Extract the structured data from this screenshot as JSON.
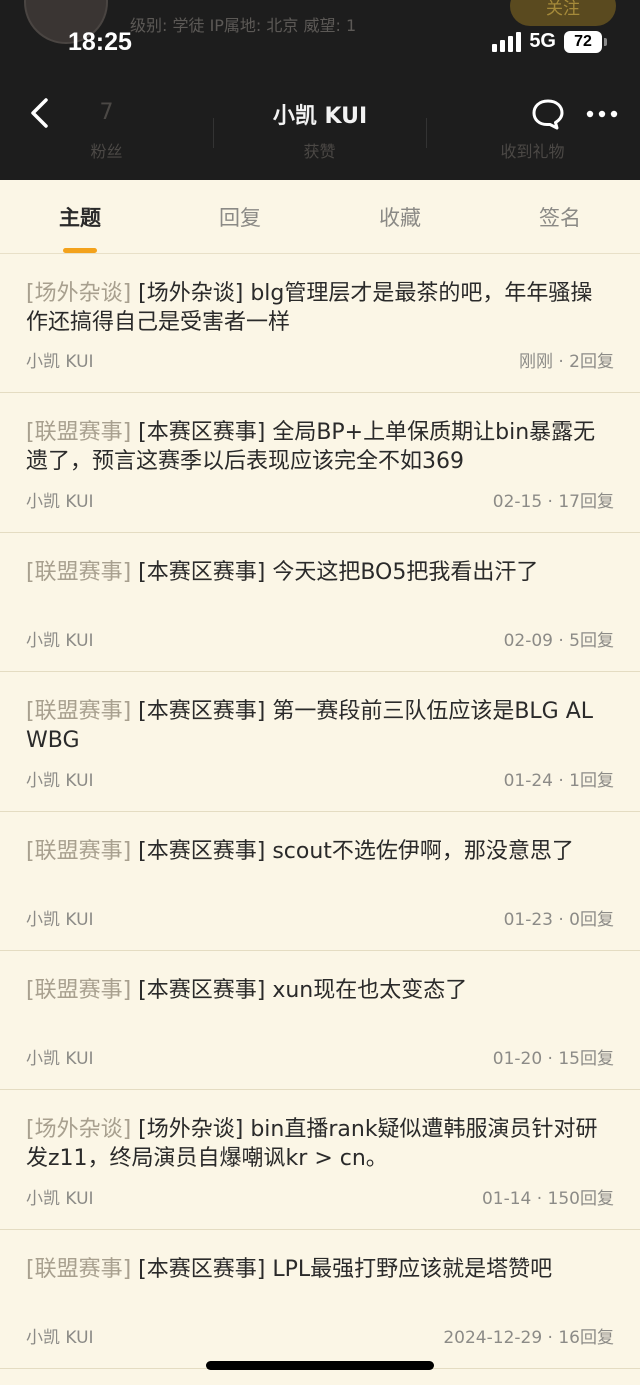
{
  "status_bar": {
    "time": "18:25",
    "network": "5G",
    "battery": "72"
  },
  "background_profile": {
    "meta_line": "级别: 学徒  IP属地: 北京  威望: 1",
    "follow_label": "关注",
    "stats": [
      {
        "num": "7",
        "label": "粉丝"
      },
      {
        "num": "",
        "label": "获赞"
      },
      {
        "num": "",
        "label": "收到礼物"
      }
    ]
  },
  "nav": {
    "title": "小凯 KUI"
  },
  "tabs": [
    {
      "label": "主题",
      "active": true
    },
    {
      "label": "回复",
      "active": false
    },
    {
      "label": "收藏",
      "active": false
    },
    {
      "label": "签名",
      "active": false
    }
  ],
  "posts": [
    {
      "forum": "[场外杂谈]",
      "title": " [场外杂谈] blg管理层才是最茶的吧，年年骚操作还搞得自己是受害者一样",
      "author": "小凯 KUI",
      "meta": "刚刚 · 2回复"
    },
    {
      "forum": "[联盟赛事]",
      "title": " [本赛区赛事] 全局BP+上单保质期让bin暴露无遗了，预言这赛季以后表现应该完全不如369",
      "author": "小凯 KUI",
      "meta": "02-15 · 17回复"
    },
    {
      "forum": "[联盟赛事]",
      "title": " [本赛区赛事] 今天这把BO5把我看出汗了",
      "author": "小凯 KUI",
      "meta": "02-09 · 5回复"
    },
    {
      "forum": "[联盟赛事]",
      "title": " [本赛区赛事] 第一赛段前三队伍应该是BLG AL WBG",
      "author": "小凯 KUI",
      "meta": "01-24 · 1回复"
    },
    {
      "forum": "[联盟赛事]",
      "title": " [本赛区赛事] scout不选佐伊啊，那没意思了",
      "author": "小凯 KUI",
      "meta": "01-23 · 0回复"
    },
    {
      "forum": "[联盟赛事]",
      "title": " [本赛区赛事] xun现在也太变态了",
      "author": "小凯 KUI",
      "meta": "01-20 · 15回复"
    },
    {
      "forum": "[场外杂谈]",
      "title": " [场外杂谈] bin直播rank疑似遭韩服演员针对研发z11，终局演员自爆嘲讽kr > cn。",
      "author": "小凯 KUI",
      "meta": "01-14 · 150回复"
    },
    {
      "forum": "[联盟赛事]",
      "title": " [本赛区赛事] LPL最强打野应该就是塔赞吧",
      "author": "小凯 KUI",
      "meta": "2024-12-29 · 16回复"
    }
  ]
}
